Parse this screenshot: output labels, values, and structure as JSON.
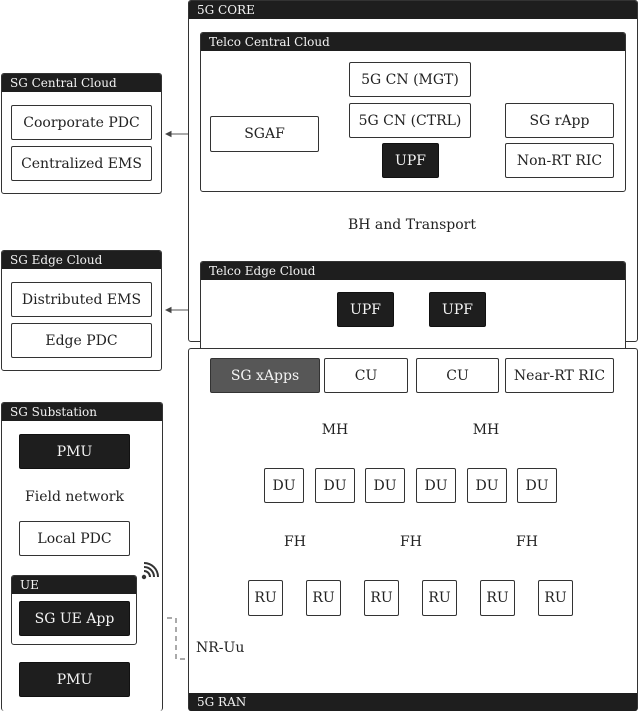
{
  "core": {
    "title": "5G CORE",
    "central": {
      "title": "Telco Central Cloud",
      "sgaf": "SGAF",
      "cn_mgt": "5G CN (MGT)",
      "cn_ctrl": "5G CN (CTRL)",
      "upf": "UPF",
      "rapp": "SG rApp",
      "nonrt_ric": "Non-RT RIC"
    },
    "bh": "BH and Transport",
    "edge": {
      "title": "Telco Edge Cloud",
      "upf1": "UPF",
      "upf2": "UPF"
    }
  },
  "sg_central": {
    "title": "SG Central Cloud",
    "items": [
      "Coorporate PDC",
      "Centralized EMS"
    ]
  },
  "sg_edge": {
    "title": "SG Edge Cloud",
    "items": [
      "Distributed EMS",
      "Edge PDC"
    ]
  },
  "substation": {
    "title": "SG Substation",
    "pmu_top": "PMU",
    "field_network": "Field network",
    "local_pdc": "Local PDC",
    "ue_title": "UE",
    "ue_app": "SG UE App",
    "pmu_bottom": "PMU",
    "wifi_icon": "wireless-signal"
  },
  "ran": {
    "title": "5G RAN",
    "xapps": "SG xApps",
    "cu1": "CU",
    "cu2": "CU",
    "nearrt_ric": "Near-RT RIC",
    "mh": [
      "MH",
      "MH"
    ],
    "du": [
      "DU",
      "DU",
      "DU",
      "DU",
      "DU",
      "DU"
    ],
    "fh": [
      "FH",
      "FH",
      "FH"
    ],
    "ru": [
      "RU",
      "RU",
      "RU",
      "RU",
      "RU",
      "RU"
    ],
    "tower_icon": "cell-tower",
    "nr_uu": "NR-Uu"
  }
}
